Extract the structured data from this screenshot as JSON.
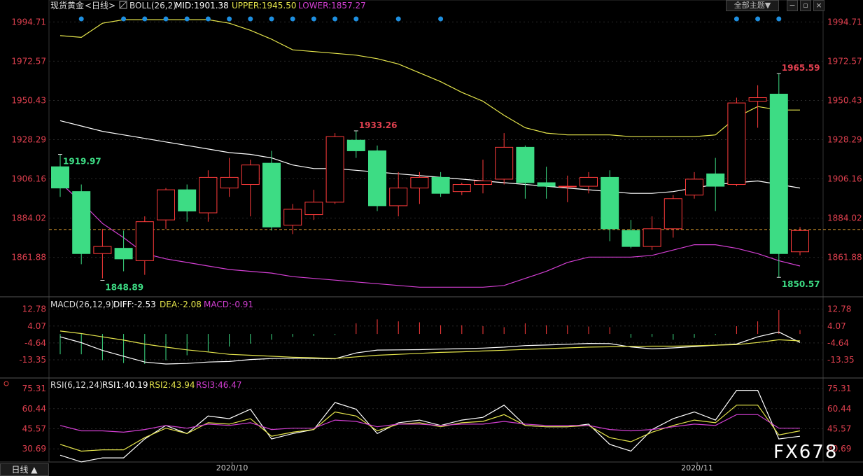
{
  "header": {
    "instrument": "现货黄金",
    "period_tag": "<日线>",
    "boll_name": "BOLL(26,2)",
    "mid": "MID:1901.38",
    "upper": "UPPER:1945.50",
    "lower": "LOWER:1857.27",
    "theme_button": "全部主题▼"
  },
  "macd_header": {
    "name": "MACD(26,12,9)",
    "diff": "DIFF:-2.53",
    "dea": "DEA:-2.08",
    "macd": "MACD:-0.91"
  },
  "rsi_header": {
    "name": "RSI(6,12,24)",
    "rsi1": "RSI1:40.19",
    "rsi2": "RSI2:43.94",
    "rsi3": "RSI3:46.47"
  },
  "footer": {
    "period_button": "日线 ▲",
    "watermark": "FX678"
  },
  "colors": {
    "up": "#ff3b3b",
    "down": "#3ddc84",
    "mid": "#ffffff",
    "upper": "#e6e64c",
    "lower": "#d43fd4",
    "axis_text": "#e0404f",
    "dot": "#1e8fe0",
    "grid": "#2a2a2a"
  },
  "chart_data": [
    {
      "type": "candlestick",
      "title": "现货黄金 <日线>",
      "ylim": [
        1840.0,
        2000.0
      ],
      "yticks": [
        1994.71,
        1972.57,
        1950.43,
        1928.29,
        1906.16,
        1884.02,
        1861.88
      ],
      "xtick_labels": [
        {
          "index": 8,
          "label": "2020/10"
        },
        {
          "index": 30,
          "label": "2020/11"
        }
      ],
      "current_price": 1877.6,
      "candles": [
        [
          1913.0,
          1920.0,
          1896.0,
          1901.0
        ],
        [
          1899.0,
          1903.0,
          1858.0,
          1864.0
        ],
        [
          1864.0,
          1878.0,
          1850.0,
          1868.0
        ],
        [
          1867.0,
          1877.0,
          1854.0,
          1861.0
        ],
        [
          1860.0,
          1885.0,
          1852.0,
          1882.0
        ],
        [
          1883.0,
          1901.0,
          1878.0,
          1900.0
        ],
        [
          1900.0,
          1903.0,
          1882.0,
          1888.0
        ],
        [
          1887.0,
          1911.0,
          1882.0,
          1907.0
        ],
        [
          1901.0,
          1918.0,
          1896.0,
          1907.0
        ],
        [
          1903.0,
          1917.0,
          1885.0,
          1914.0
        ],
        [
          1915.0,
          1922.0,
          1877.0,
          1879.0
        ],
        [
          1880.0,
          1892.0,
          1875.0,
          1889.0
        ],
        [
          1886.0,
          1900.0,
          1883.0,
          1893.0
        ],
        [
          1893.0,
          1932.0,
          1892.0,
          1930.0
        ],
        [
          1928.0,
          1933.26,
          1918.0,
          1922.0
        ],
        [
          1922.0,
          1925.0,
          1888.0,
          1891.0
        ],
        [
          1891.0,
          1910.0,
          1885.0,
          1901.0
        ],
        [
          1901.0,
          1910.0,
          1892.0,
          1907.0
        ],
        [
          1907.0,
          1910.0,
          1896.0,
          1898.0
        ],
        [
          1899.0,
          1904.0,
          1897.0,
          1903.0
        ],
        [
          1903.0,
          1917.0,
          1898.0,
          1905.0
        ],
        [
          1906.0,
          1932.0,
          1903.0,
          1924.0
        ],
        [
          1924.0,
          1925.0,
          1895.0,
          1904.0
        ],
        [
          1904.0,
          1913.0,
          1895.0,
          1902.0
        ],
        [
          1902.0,
          1908.0,
          1893.0,
          1902.0
        ],
        [
          1902.0,
          1910.0,
          1898.0,
          1907.0
        ],
        [
          1907.0,
          1911.0,
          1871.0,
          1878.0
        ],
        [
          1877.0,
          1883.0,
          1867.0,
          1868.0
        ],
        [
          1868.0,
          1885.0,
          1866.0,
          1878.0
        ],
        [
          1878.0,
          1897.0,
          1873.0,
          1895.0
        ],
        [
          1897.0,
          1910.0,
          1895.0,
          1906.0
        ],
        [
          1909.0,
          1918.0,
          1888.0,
          1902.0
        ],
        [
          1903.0,
          1952.0,
          1902.0,
          1949.0
        ],
        [
          1950.0,
          1959.0,
          1935.0,
          1952.0
        ],
        [
          1954.0,
          1965.59,
          1850.57,
          1864.0
        ],
        [
          1865.0,
          1879.0,
          1863.0,
          1877.0
        ]
      ],
      "boll_mid": [
        1939,
        1936,
        1933,
        1931,
        1929,
        1927,
        1925,
        1923,
        1921,
        1920,
        1918,
        1914,
        1912,
        1912,
        1911,
        1910,
        1909,
        1908,
        1907,
        1906,
        1905,
        1904,
        1903,
        1902,
        1901,
        1900,
        1899,
        1898,
        1898,
        1899,
        1901,
        1903,
        1904,
        1905,
        1903,
        1901
      ],
      "boll_upper": [
        1987,
        1986,
        1994,
        1996,
        1996,
        1996,
        1996,
        1996,
        1994,
        1990,
        1985,
        1979,
        1978,
        1977,
        1976,
        1974,
        1971,
        1966,
        1961,
        1955,
        1950,
        1942,
        1935,
        1932,
        1931,
        1931,
        1931,
        1930,
        1930,
        1930,
        1930,
        1931,
        1941,
        1947,
        1945,
        1945
      ],
      "boll_lower": [
        1904,
        1893,
        1881,
        1873,
        1864,
        1861,
        1859,
        1857,
        1855,
        1854,
        1853,
        1851,
        1850,
        1849,
        1848,
        1847,
        1846,
        1845,
        1845,
        1845,
        1845,
        1846,
        1850,
        1854,
        1859,
        1862,
        1862,
        1862,
        1863,
        1866,
        1869,
        1869,
        1867,
        1864,
        1860,
        1857
      ],
      "high_low_labels": [
        {
          "index": 0,
          "price": 1919.97,
          "text": "1919.97"
        },
        {
          "index": 2,
          "price": 1848.89,
          "text": "1848.89"
        },
        {
          "index": 14,
          "price": 1933.26,
          "text": "1933.26"
        },
        {
          "index": 34,
          "price": 1965.59,
          "text": "1965.59"
        },
        {
          "index": 34,
          "price": 1850.57,
          "text": "1850.57"
        }
      ],
      "signal_dot_indices": [
        1,
        3,
        4,
        5,
        6,
        7,
        8,
        9,
        10,
        11,
        12,
        13,
        14,
        16,
        18,
        32,
        33,
        34
      ]
    },
    {
      "type": "bar",
      "title": "MACD(26,12,9)",
      "ylim": [
        -22,
        17
      ],
      "yticks": [
        12.78,
        4.07,
        -4.64,
        -13.35
      ],
      "diff": [
        -1.5,
        -4.5,
        -8.5,
        -11.5,
        -14.5,
        -15.5,
        -15.2,
        -14.5,
        -14.2,
        -13.2,
        -12.7,
        -12.5,
        -12.6,
        -12.8,
        -9.8,
        -8.3,
        -8.2,
        -8.1,
        -7.8,
        -7.6,
        -7.3,
        -6.8,
        -6.0,
        -5.7,
        -5.3,
        -4.9,
        -5.0,
        -6.7,
        -7.7,
        -7.2,
        -6.5,
        -5.8,
        -5.2,
        -1.5,
        1.0,
        -4.4
      ],
      "dea": [
        1.5,
        0.2,
        -1.5,
        -3.2,
        -5.2,
        -6.8,
        -8.2,
        -9.3,
        -10.5,
        -11.0,
        -11.5,
        -12.0,
        -12.3,
        -12.7,
        -11.8,
        -11.0,
        -10.5,
        -10.0,
        -9.5,
        -9.2,
        -8.8,
        -8.4,
        -8.0,
        -7.6,
        -7.2,
        -6.8,
        -6.6,
        -6.4,
        -6.3,
        -6.3,
        -6.1,
        -5.8,
        -5.5,
        -4.4,
        -3.0,
        -3.6
      ],
      "macd": [
        -10.5,
        -10.5,
        -13.5,
        -15.0,
        -15.5,
        -13.5,
        -11.0,
        -9.0,
        -6.5,
        -5.0,
        -3.0,
        -1.5,
        -1.0,
        -0.5,
        5.5,
        7.5,
        6.5,
        6.0,
        4.5,
        4.5,
        4.0,
        3.5,
        5.5,
        4.5,
        4.5,
        3.8,
        3.5,
        -2.0,
        -1.5,
        -3.0,
        -2.0,
        -0.5,
        4.0,
        6.5,
        12.3,
        2.0
      ],
      "series": [
        {
          "name": "DIFF",
          "values": [
            -1.5,
            -4.5,
            -8.5,
            -11.5,
            -14.5,
            -15.5,
            -15.2,
            -14.5,
            -14.2,
            -13.2,
            -12.7,
            -12.5,
            -12.6,
            -12.8,
            -9.8,
            -8.3,
            -8.2,
            -8.1,
            -7.8,
            -7.6,
            -7.3,
            -6.8,
            -6.0,
            -5.7,
            -5.3,
            -4.9,
            -5.0,
            -6.7,
            -7.7,
            -7.2,
            -6.5,
            -5.8,
            -5.2,
            -1.5,
            1.0,
            -4.4
          ]
        },
        {
          "name": "DEA",
          "values": [
            1.5,
            0.2,
            -1.5,
            -3.2,
            -5.2,
            -6.8,
            -8.2,
            -9.3,
            -10.5,
            -11.0,
            -11.5,
            -12.0,
            -12.3,
            -12.7,
            -11.8,
            -11.0,
            -10.5,
            -10.0,
            -9.5,
            -9.2,
            -8.8,
            -8.4,
            -8.0,
            -7.6,
            -7.2,
            -6.8,
            -6.6,
            -6.4,
            -6.3,
            -6.3,
            -6.1,
            -5.8,
            -5.5,
            -4.4,
            -3.0,
            -3.6
          ]
        },
        {
          "name": "MACD",
          "values": [
            -10.5,
            -10.5,
            -13.5,
            -15.0,
            -15.5,
            -13.5,
            -11.0,
            -9.0,
            -6.5,
            -5.0,
            -3.0,
            -1.5,
            -1.0,
            -0.5,
            5.5,
            7.5,
            6.5,
            6.0,
            4.5,
            4.5,
            4.0,
            3.5,
            5.5,
            4.5,
            4.5,
            3.8,
            3.5,
            -2.0,
            -1.5,
            -3.0,
            -2.0,
            -0.5,
            4.0,
            6.5,
            12.3,
            2.0
          ]
        }
      ]
    },
    {
      "type": "line",
      "title": "RSI(6,12,24)",
      "ylim": [
        22,
        80
      ],
      "yticks": [
        75.31,
        60.44,
        45.57,
        30.69
      ],
      "series": [
        {
          "name": "RSI1",
          "values": [
            26,
            21,
            24,
            24,
            38,
            48,
            42,
            55,
            53,
            60,
            38,
            42,
            45,
            65,
            60,
            42,
            50,
            52,
            48,
            52,
            54,
            63,
            48,
            47,
            47,
            49,
            34,
            29,
            45,
            53,
            58,
            52,
            74,
            74,
            38,
            40
          ]
        },
        {
          "name": "RSI2",
          "values": [
            34,
            29,
            30,
            30,
            39,
            46,
            42,
            50,
            49,
            53,
            40,
            43,
            45,
            58,
            55,
            44,
            49,
            50,
            47,
            50,
            51,
            56,
            48,
            47,
            47,
            48,
            39,
            36,
            43,
            48,
            52,
            50,
            63,
            63,
            41,
            44
          ]
        },
        {
          "name": "RSI3",
          "values": [
            48,
            44,
            44,
            43,
            45,
            48,
            46,
            49,
            48,
            50,
            45,
            46,
            46,
            52,
            51,
            47,
            49,
            49,
            48,
            49,
            49,
            51,
            49,
            48,
            48,
            48,
            45,
            44,
            45,
            47,
            49,
            48,
            56,
            56,
            46,
            46
          ]
        }
      ]
    }
  ]
}
